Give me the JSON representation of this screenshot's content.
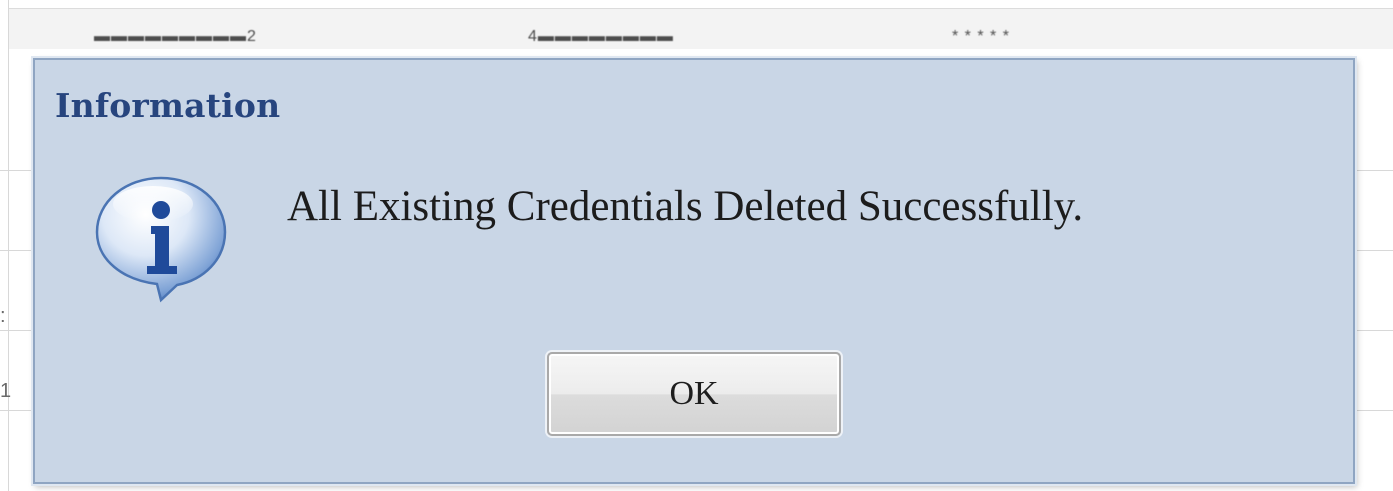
{
  "dialog": {
    "title": "Information",
    "message": "All Existing Credentials Deleted Successfully.",
    "ok_label": "OK",
    "icon": "info-icon"
  },
  "background": {
    "left_fragments": [
      ":",
      "1"
    ]
  },
  "colors": {
    "dialog_bg": "#c9d6e6",
    "title": "#27457e",
    "icon_blue": "#1f4a9a"
  }
}
